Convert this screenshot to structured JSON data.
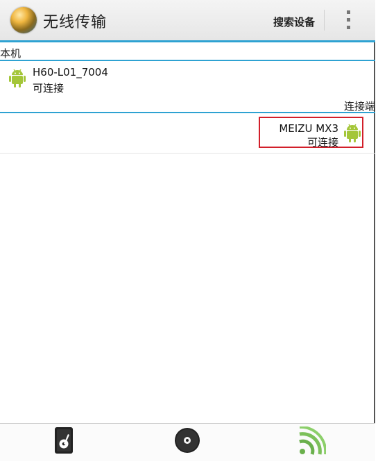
{
  "header": {
    "app_title": "无线传输",
    "search_label": "搜索设备"
  },
  "local": {
    "section_label": "本机",
    "device": {
      "name": "H60-L01_7004",
      "status": "可连接"
    }
  },
  "connector": {
    "section_label": "连接端",
    "device": {
      "name": "MEIZU MX3",
      "status": "可连接"
    }
  },
  "colors": {
    "accent": "#2ea2d2",
    "android_green": "#a4c639",
    "highlight_border": "#d21f2a"
  },
  "bottom_tabs": [
    {
      "icon": "music-file-icon"
    },
    {
      "icon": "disc-icon"
    },
    {
      "icon": "rss-feed-icon"
    }
  ]
}
